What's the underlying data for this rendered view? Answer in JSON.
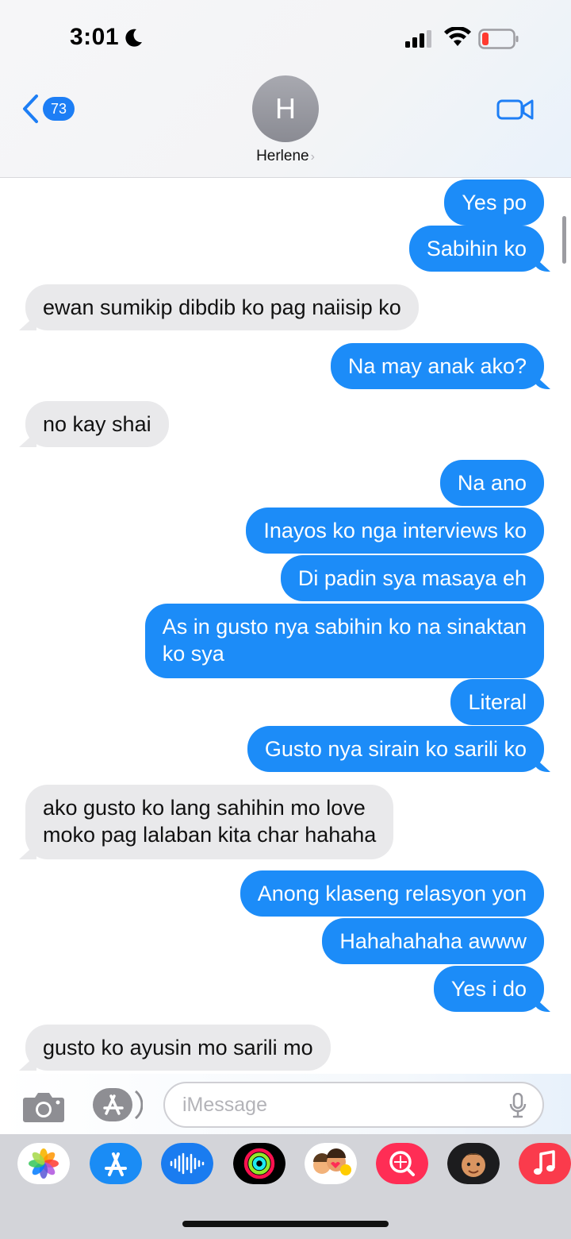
{
  "status_bar": {
    "time": "3:01"
  },
  "header": {
    "back_count": "73",
    "avatar_initial": "H",
    "contact_name": "Herlene",
    "name_chevron": "›"
  },
  "messages": [
    {
      "from": "me",
      "text": "Yes po"
    },
    {
      "from": "me",
      "text": "Sabihin ko"
    },
    {
      "from": "them",
      "text": "ewan sumikip dibdib ko pag naiisip ko"
    },
    {
      "from": "me",
      "text": "Na may anak ako?"
    },
    {
      "from": "them",
      "text": "no kay shai"
    },
    {
      "from": "me",
      "text": "Na ano"
    },
    {
      "from": "me",
      "text": "Inayos ko nga interviews ko"
    },
    {
      "from": "me",
      "text": "Di padin sya masaya eh"
    },
    {
      "from": "me",
      "line1": "As in gusto nya sabihin ko na sinaktan",
      "line2": "ko sya"
    },
    {
      "from": "me",
      "text": "Literal"
    },
    {
      "from": "me",
      "text": "Gusto nya sirain ko sarili ko"
    },
    {
      "from": "them",
      "line1": "ako gusto ko lang sahihin mo love",
      "line2": "moko pag lalaban kita char hahaha"
    },
    {
      "from": "me",
      "text": "Anong klaseng relasyon yon"
    },
    {
      "from": "me",
      "text": "Hahahahaha awww"
    },
    {
      "from": "me",
      "text": "Yes i do"
    },
    {
      "from": "them",
      "text": "gusto ko ayusin mo sarili mo"
    }
  ],
  "input": {
    "placeholder": "iMessage"
  },
  "apps": [
    "photos-icon",
    "app-store-icon",
    "audio-message-icon",
    "activity-icon",
    "memoji-stickers-icon",
    "search-images-icon",
    "memoji-icon",
    "music-icon"
  ],
  "colors": {
    "sent_bubble": "#1c8cf8",
    "received_bubble": "#e9e9eb",
    "badge": "#1d7ef5"
  }
}
